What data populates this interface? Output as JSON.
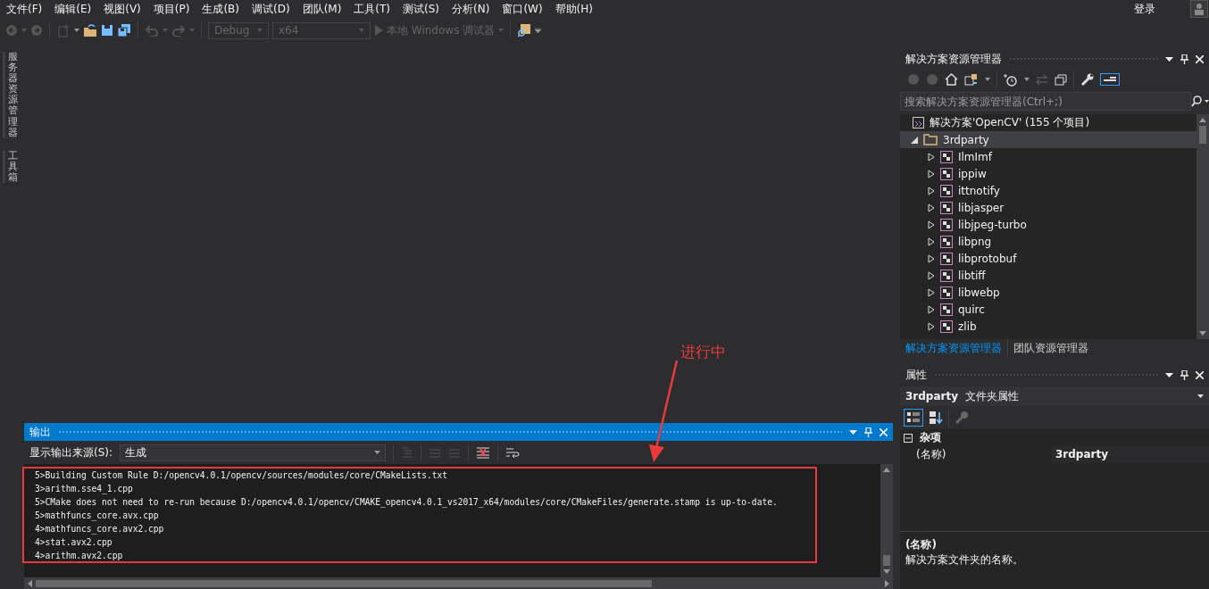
{
  "menu": [
    "文件(F)",
    "编辑(E)",
    "视图(V)",
    "项目(P)",
    "生成(B)",
    "调试(D)",
    "团队(M)",
    "工具(T)",
    "测试(S)",
    "分析(N)",
    "窗口(W)",
    "帮助(H)"
  ],
  "account": {
    "sign_in": "登录"
  },
  "toolbar": {
    "configuration": "Debug",
    "platform": "x64",
    "debugger": "本地 Windows 调试器"
  },
  "side_tabs": [
    "服务器资源管理器",
    "工具箱"
  ],
  "solution_explorer": {
    "title": "解决方案资源管理器",
    "search": {
      "placeholder": "搜索解决方案资源管理器(Ctrl+;)"
    },
    "tree": {
      "label": "解决方案'OpenCV' (155 个项目)",
      "children": [
        {
          "label": "3rdparty",
          "expanded": true,
          "selected": true,
          "children": [
            {
              "label": "IlmImf",
              "expanded": false,
              "selected": false
            },
            {
              "label": "ippiw",
              "expanded": false,
              "selected": false
            },
            {
              "label": "ittnotify",
              "expanded": false,
              "selected": false
            },
            {
              "label": "libjasper",
              "expanded": false,
              "selected": false
            },
            {
              "label": "libjpeg-turbo",
              "expanded": false,
              "selected": false
            },
            {
              "label": "libpng",
              "expanded": false,
              "selected": false
            },
            {
              "label": "libprotobuf",
              "expanded": false,
              "selected": false
            },
            {
              "label": "libtiff",
              "expanded": false,
              "selected": false
            },
            {
              "label": "libwebp",
              "expanded": false,
              "selected": false
            },
            {
              "label": "quirc",
              "expanded": false,
              "selected": false
            },
            {
              "label": "zlib",
              "expanded": false,
              "selected": false
            }
          ]
        }
      ]
    },
    "tabs": [
      {
        "label": "解决方案资源管理器",
        "selected": true
      },
      {
        "label": "团队资源管理器",
        "selected": false
      }
    ]
  },
  "properties": {
    "title": "属性",
    "object": "3rdparty",
    "object_type": "文件夹属性",
    "category": {
      "label": "杂项",
      "expanded": true
    },
    "rows": [
      {
        "name": "(名称)",
        "value": "3rdparty"
      }
    ],
    "description": {
      "title": "(名称)",
      "text": "解决方案文件夹的名称。"
    }
  },
  "output": {
    "title": "输出",
    "source_label": "显示输出来源(S):",
    "source": "生成",
    "lines": [
      "5>Building Custom Rule D:/opencv4.0.1/opencv/sources/modules/core/CMakeLists.txt",
      "3>arithm.sse4_1.cpp",
      "5>CMake does not need to re-run because D:/opencv4.0.1/opencv/CMAKE_opencv4.0.1_vs2017_x64/modules/core/CMakeFiles/generate.stamp is up-to-date.",
      "5>mathfuncs_core.avx.cpp",
      "4>mathfuncs_core.avx2.cpp",
      "4>stat.avx2.cpp",
      "4>arithm.avx2.cpp"
    ]
  },
  "annotation": {
    "label": "进行中"
  }
}
